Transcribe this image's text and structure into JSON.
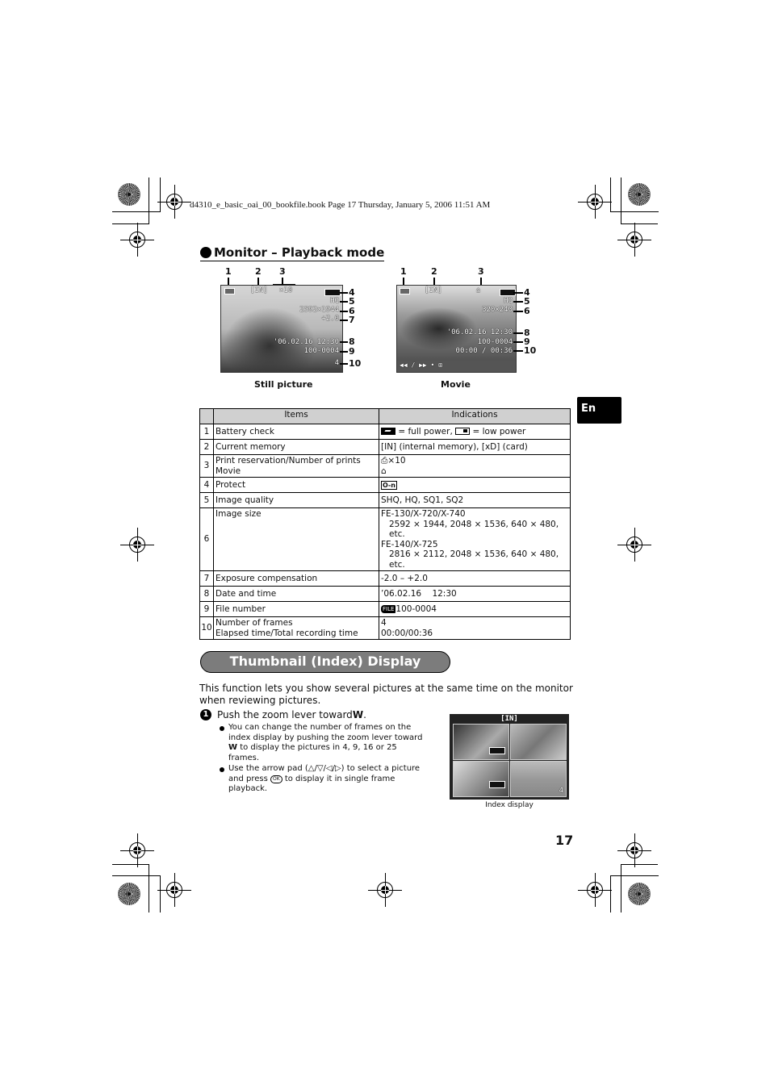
{
  "print_header": {
    "text": "d4310_e_basic_oai_00_bookfile.book  Page 17  Thursday, January 5, 2006  11:51 AM"
  },
  "section_monitor": {
    "title": "Monitor – Playback mode",
    "still": {
      "caption": "Still picture",
      "callouts_top": [
        "1",
        "2",
        "3"
      ],
      "callouts_right": [
        "4",
        "5",
        "6",
        "7",
        "8",
        "9",
        "10"
      ],
      "osd": {
        "memory": "[IN]",
        "prints": "×10",
        "quality": "HQ",
        "size": "2592×1944",
        "exposure": "+2.0",
        "datetime": "'06.02.16  12:30",
        "file": "100-0004",
        "frames": "4"
      }
    },
    "movie": {
      "caption": "Movie",
      "callouts_top": [
        "1",
        "2",
        "3"
      ],
      "callouts_right": [
        "4",
        "5",
        "6",
        "8",
        "9",
        "10"
      ],
      "osd": {
        "memory": "[IN]",
        "quality": "HQ",
        "size": "320×240",
        "datetime": "'06.02.16  12:30",
        "file": "100-0004",
        "time": "00:00 / 00:36",
        "controls": "◀◀ / ▶▶ • ⊞"
      }
    }
  },
  "lang_tab": "En",
  "table": {
    "headers": [
      "",
      "Items",
      "Indications"
    ],
    "rows": [
      {
        "num": "1",
        "items": [
          "Battery check"
        ],
        "indications": [
          "= full power, ",
          "= low power"
        ]
      },
      {
        "num": "2",
        "items": [
          "Current memory"
        ],
        "indications": [
          "[IN] (internal memory), [xD] (card)"
        ]
      },
      {
        "num": "3",
        "items": [
          "Print reservation/Number of prints",
          "Movie"
        ],
        "indications": [
          "×10",
          ""
        ]
      },
      {
        "num": "4",
        "items": [
          "Protect"
        ],
        "indications": [
          "O-n"
        ]
      },
      {
        "num": "5",
        "items": [
          "Image quality"
        ],
        "indications": [
          "SHQ, HQ, SQ1, SQ2"
        ]
      },
      {
        "num": "6",
        "items": [
          "Image size"
        ],
        "indications": [
          "FE-130/X-720/X-740",
          "2592 × 1944, 2048 × 1536, 640 × 480, etc.",
          "FE-140/X-725",
          "2816 × 2112, 2048 × 1536, 640 × 480, etc."
        ]
      },
      {
        "num": "7",
        "items": [
          "Exposure compensation"
        ],
        "indications": [
          "-2.0 – +2.0"
        ]
      },
      {
        "num": "8",
        "items": [
          "Date and time"
        ],
        "indications": [
          "’06.02.16    12:30"
        ]
      },
      {
        "num": "9",
        "items": [
          "File number"
        ],
        "indications": [
          "FILE",
          "100-0004"
        ]
      },
      {
        "num": "10",
        "items": [
          "Number of frames",
          "Elapsed time/Total recording time"
        ],
        "indications": [
          "4",
          "00:00/00:36"
        ]
      }
    ]
  },
  "section_thumbnail": {
    "title": "Thumbnail (Index) Display",
    "intro": "This function lets you show several pictures at the same time on the monitor when reviewing pictures.",
    "step": {
      "num": "1",
      "text_before": "Push the zoom lever toward ",
      "bold": "W",
      "text_after": "."
    },
    "bullets": [
      {
        "before": "You can change the number of frames on the index display by pushing the zoom lever toward ",
        "bold": "W",
        "after": " to display the pictures in 4, 9, 16 or 25 frames."
      },
      {
        "before": "Use the arrow pad (△/▽/◁/▷) to select a picture and press ",
        "ok": "OK",
        "after": " to display it in single frame playback."
      }
    ],
    "index_display": {
      "header": "[IN]",
      "caption": "Index display",
      "frame_count": "4"
    }
  },
  "page_number": "17"
}
